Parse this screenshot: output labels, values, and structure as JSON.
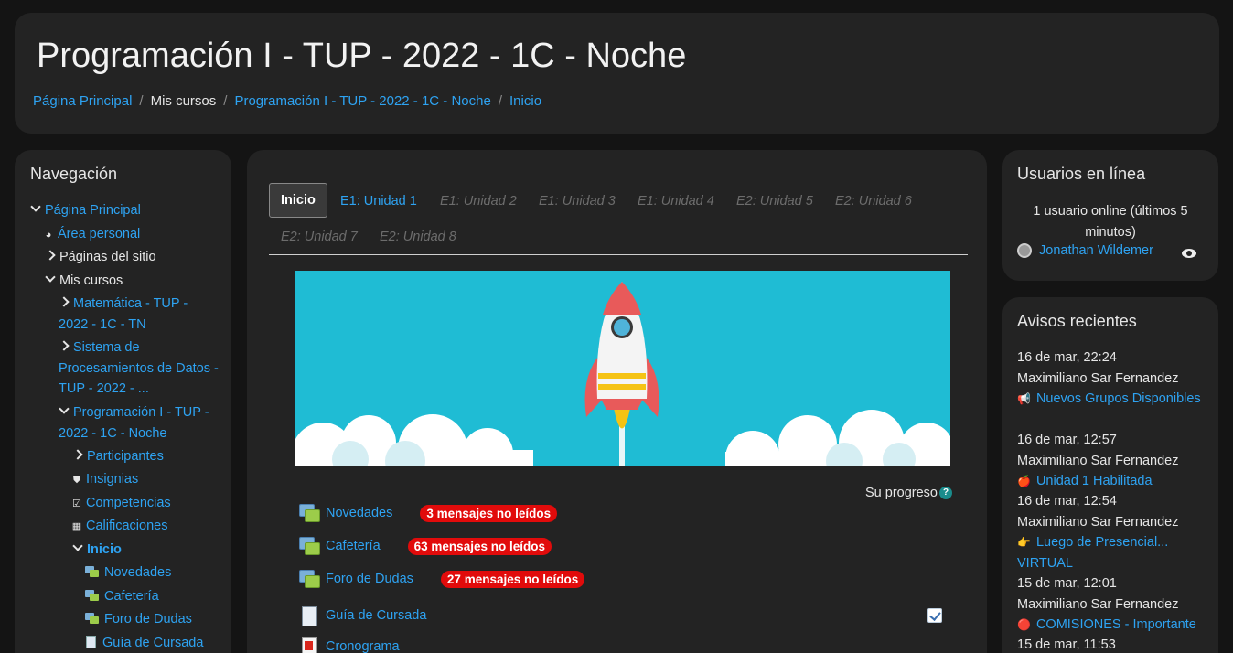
{
  "header": {
    "title": "Programación I - TUP - 2022 - 1C - Noche",
    "breadcrumb": [
      "Página Principal",
      "Mis cursos",
      "Programación I - TUP - 2022 - 1C - Noche",
      "Inicio"
    ]
  },
  "nav": {
    "title": "Navegación",
    "items": [
      {
        "label": "Página Principal"
      },
      {
        "label": "Área personal"
      },
      {
        "label": "Páginas del sitio"
      },
      {
        "label": "Mis cursos"
      },
      {
        "label": "Matemática - TUP - 2022 - 1C - TN"
      },
      {
        "label": "Sistema de Procesamientos de Datos - TUP - 2022 - ..."
      },
      {
        "label": "Programación I - TUP - 2022 - 1C - Noche"
      },
      {
        "label": "Participantes"
      },
      {
        "label": "Insignias"
      },
      {
        "label": "Competencias"
      },
      {
        "label": "Calificaciones"
      },
      {
        "label": "Inicio"
      },
      {
        "label": "Novedades"
      },
      {
        "label": "Cafetería"
      },
      {
        "label": "Foro de Dudas"
      },
      {
        "label": "Guía de Cursada"
      }
    ]
  },
  "tabs": [
    "Inicio",
    "E1: Unidad 1",
    "E1: Unidad 2",
    "E1: Unidad 3",
    "E1: Unidad 4",
    "E2: Unidad 5",
    "E2: Unidad 6",
    "E2: Unidad 7",
    "E2: Unidad 8"
  ],
  "progress_label": "Su progreso",
  "help_glyph": "?",
  "activities": [
    {
      "label": "Novedades",
      "badge": "3 mensajes no leídos"
    },
    {
      "label": "Cafetería",
      "badge": "63 mensajes no leídos"
    },
    {
      "label": "Foro de Dudas",
      "badge": "27 mensajes no leídos"
    },
    {
      "label": "Guía de Cursada",
      "badge": ""
    },
    {
      "label": "Cronograma",
      "badge": ""
    }
  ],
  "online": {
    "title": "Usuarios en línea",
    "count_text": "1 usuario online (últimos 5 minutos)",
    "user": "Jonathan Wildemer"
  },
  "avisos": {
    "title": "Avisos recientes",
    "items": [
      {
        "date": "16 de mar, 22:24",
        "author": "Maximiliano Sar Fernandez",
        "emoji": "📢",
        "subject": "Nuevos Grupos Disponibles"
      },
      {
        "date": "16 de mar, 12:57",
        "author": "Maximiliano Sar Fernandez",
        "emoji": "🍎",
        "subject": "Unidad 1 Habilitada"
      },
      {
        "date": "16 de mar, 12:54",
        "author": "Maximiliano Sar Fernandez",
        "emoji": "👉",
        "subject": "Luego de Presencial... VIRTUAL"
      },
      {
        "date": "15 de mar, 12:01",
        "author": "Maximiliano Sar Fernandez",
        "emoji": "🔴",
        "subject": "COMISIONES - Importante"
      },
      {
        "date": "15 de mar, 11:53",
        "author": "",
        "emoji": "",
        "subject": ""
      }
    ]
  },
  "colors": {
    "link": "#2ea3f2",
    "badge": "#e10b0b",
    "banner": "#1fbcd4",
    "card": "#232323",
    "background": "#141414"
  }
}
